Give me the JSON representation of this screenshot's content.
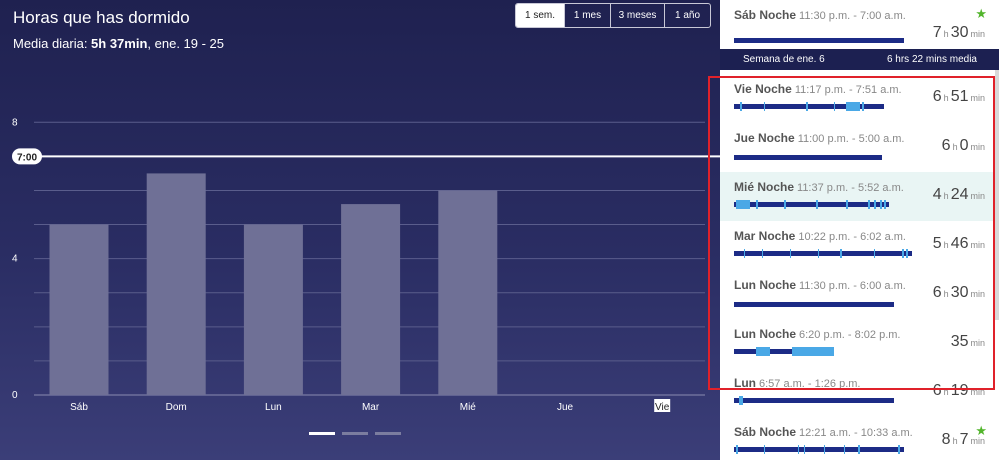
{
  "header": {
    "title": "Horas que has dormido",
    "subtitle_prefix": "Media diaria: ",
    "subtitle_value": "5h 37min",
    "subtitle_suffix": ", ene. 19 - 25"
  },
  "ranges": [
    {
      "label": "1 sem.",
      "active": true
    },
    {
      "label": "1 mes",
      "active": false
    },
    {
      "label": "3 meses",
      "active": false
    },
    {
      "label": "1 año",
      "active": false
    }
  ],
  "chart_data": {
    "type": "bar",
    "categories": [
      "Sáb",
      "Dom",
      "Lun",
      "Mar",
      "Mié",
      "Jue",
      "Vie"
    ],
    "values": [
      5.0,
      6.5,
      5.0,
      5.6,
      6.0,
      0,
      0
    ],
    "yticks": [
      0,
      4,
      8
    ],
    "ylim": [
      0,
      8.8
    ],
    "goal_label": "7:00",
    "goal_value": 7.0,
    "selected_category": "Vie",
    "bar_color": "#6f7096",
    "goal_color": "#ffffff"
  },
  "pager": {
    "pages": 3,
    "active": 0
  },
  "sleep_log": {
    "top_entry": {
      "day": "Sáb Noche",
      "time": "11:30 p.m. - 7:00 a.m.",
      "hours": "7",
      "minutes": "30",
      "star": true
    },
    "week_row": {
      "label": "Semana de ene. 6",
      "avg": "6 hrs 22 mins media"
    },
    "entries": [
      {
        "day": "Vie Noche",
        "time": "11:17 p.m. - 7:51 a.m.",
        "hours": "6",
        "minutes": "51",
        "highlighted": false,
        "star": false
      },
      {
        "day": "Jue Noche",
        "time": "11:00 p.m. - 5:00 a.m.",
        "hours": "6",
        "minutes": "0",
        "highlighted": false,
        "star": false
      },
      {
        "day": "Mié Noche",
        "time": "11:37 p.m. - 5:52 a.m.",
        "hours": "4",
        "minutes": "24",
        "highlighted": true,
        "star": false
      },
      {
        "day": "Mar Noche",
        "time": "10:22 p.m. - 6:02 a.m.",
        "hours": "5",
        "minutes": "46",
        "highlighted": false,
        "star": false
      },
      {
        "day": "Lun Noche",
        "time": "11:30 p.m. - 6:00 a.m.",
        "hours": "6",
        "minutes": "30",
        "highlighted": false,
        "star": false
      },
      {
        "day": "Lun Noche",
        "time": "6:20 p.m. - 8:02 p.m.",
        "hours": "",
        "minutes": "35",
        "highlighted": false,
        "star": false
      },
      {
        "day": "Lun",
        "time": "6:57 a.m. - 1:26 p.m.",
        "hours": "6",
        "minutes": "19",
        "highlighted": false,
        "star": false
      },
      {
        "day": "Sáb Noche",
        "time": "12:21 a.m. - 10:33 a.m.",
        "hours": "8",
        "minutes": "7",
        "highlighted": false,
        "star": true
      }
    ],
    "hour_unit": "h",
    "minute_unit": "min"
  },
  "colors": {
    "deep_sleep": "#1c2b86",
    "awake": "#4aa8e6",
    "highlight_row": "#e9f5f4",
    "annotation_box": "#e0212a",
    "star": "#52b52c"
  }
}
